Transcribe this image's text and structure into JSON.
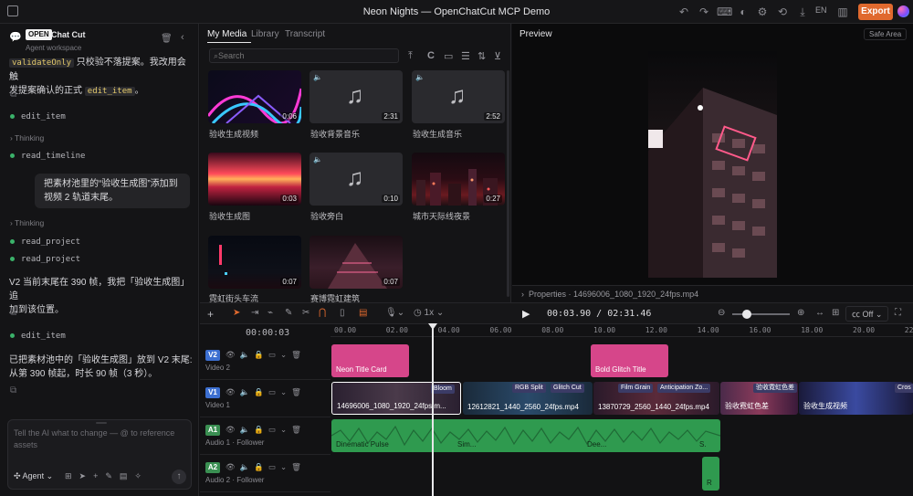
{
  "window": {
    "title": "Neon Nights — OpenChatCut MCP Demo",
    "lang": "EN",
    "export_label": "Export"
  },
  "agent": {
    "logo_text": "OPEN",
    "brand": "Chat Cut",
    "subtitle": "Agent workspace",
    "msg1_code_a": "validateOnly",
    "msg1_text_a": " 只校验不落提案。我改用会触",
    "msg1_text_b": "发提案确认的正式 ",
    "msg1_code_b": "edit_item",
    "msg1_text_c": "。",
    "tool_edit_item": "edit_item",
    "thinking": "Thinking",
    "tool_read_timeline": "read_timeline",
    "user_bubble": "把素材池里的“验收生成图”添加到视频 2 轨道末尾。",
    "tool_read_project": "read_project",
    "msg2_a": "V2 当前末尾在 390 帧，我把「验收生成图」追",
    "msg2_b": "加到该位置。",
    "msg3_a": "已把素材池中的「验收生成图」放到 V2 末尾:",
    "msg3_b": "从第 390 帧起，时长 90 帧（3 秒）。",
    "input_placeholder": "Tell the AI what to change — @ to reference assets",
    "agent_mode": "Agent"
  },
  "media": {
    "tabs": [
      "My Media",
      "Library",
      "Transcript"
    ],
    "search_placeholder": "Search",
    "items": [
      {
        "label": "验收生成视频",
        "duration": "0:06"
      },
      {
        "label": "验收背景音乐",
        "duration": "2:31"
      },
      {
        "label": "验收生成音乐",
        "duration": "2:52"
      },
      {
        "label": "验收生成图",
        "duration": "0:03"
      },
      {
        "label": "验收旁白",
        "duration": "0:10"
      },
      {
        "label": "城市天际线夜景",
        "duration": "0:27"
      },
      {
        "label": "霓虹街头车流",
        "duration": "0:07"
      },
      {
        "label": "赛博霓虹建筑",
        "duration": "0:07"
      }
    ]
  },
  "preview": {
    "label": "Preview",
    "safe_area": "Safe Area",
    "properties": "Properties · 14696006_1080_1920_24fps.mp4"
  },
  "timeline": {
    "timecode": "00:03.90 / 02:31.46",
    "head_timecode": "00:00:03",
    "speed": "1x",
    "cc": "Off",
    "ticks": [
      "00.00",
      "02.00",
      "04.00",
      "06.00",
      "08.00",
      "10.00",
      "12.00",
      "14.00",
      "16.00",
      "18.00",
      "20.00",
      "22"
    ],
    "tracks": [
      {
        "badge": "V2",
        "name": "Video 2"
      },
      {
        "badge": "V1",
        "name": "Video 1"
      },
      {
        "badge": "A1",
        "name": "Audio 1 · Follower"
      },
      {
        "badge": "A2",
        "name": "Audio 2 · Follower"
      }
    ],
    "v2_clips": [
      "Neon Title Card",
      "Bold Glitch Title"
    ],
    "v1_clips": [
      "14696006_1080_1920_24fps.m...",
      "12612821_1440_2560_24fps.mp4",
      "13870729_2560_1440_24fps.mp4",
      "验收霓虹色差",
      "验收生成视频"
    ],
    "v1_effects": [
      "Bloom",
      "RGB Split",
      "Glitch Cut",
      "Film Grain",
      "Anticipation Zo...",
      "验收霓虹色差",
      "Cros"
    ],
    "a1_clips": [
      "Dinematic Pulse",
      "Sim...",
      "Dee...",
      "S."
    ],
    "a2_clip": "R"
  },
  "colors": {
    "accent": "#e0692e",
    "v2_clip": "#d6468a",
    "a_clip": "#2f9a4f",
    "v1_badge": "#3c6fd1",
    "a_badge": "#3a8f52"
  }
}
